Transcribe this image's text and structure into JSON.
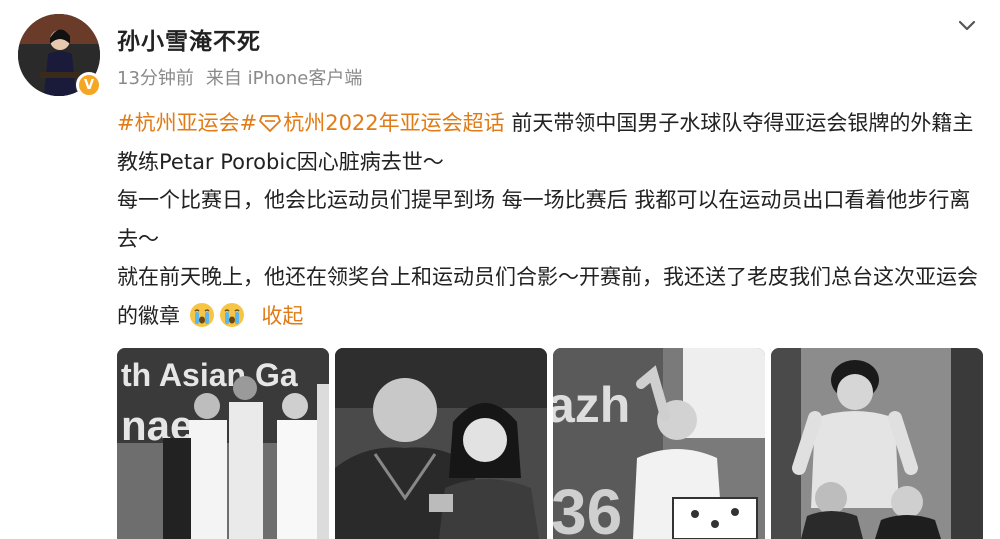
{
  "post": {
    "username": "孙小雪淹不死",
    "time": "13分钟前",
    "source": "来自 iPhone客户端",
    "hashtag1": "#杭州亚运会#",
    "hashtag2": "杭州2022年亚运会超话",
    "line1_rest": " 前天带领中国男子水球队夺得亚运会银牌的外籍主教练Petar Porobic因心脏病去世～",
    "line2": "每一个比赛日，他会比运动员们提早到场 每一场比赛后 我都可以在运动员出口看着他步行离去～",
    "line3": "就在前天晚上，他还在领奖台上和运动员们合影～开赛前，我还送了老皮我们总台这次亚运会的徽章",
    "collapse": "收起"
  },
  "photo_texts": {
    "photo1_sign": "th Asian Ga",
    "photo1_sign2": "nae",
    "photo3_sign": "azh",
    "photo3_num": "36"
  },
  "colors": {
    "accent": "#e07b16",
    "meta": "#8a8a8a",
    "text": "#222222"
  },
  "icons": [
    "verified-badge-icon",
    "chevron-down-icon",
    "super-topic-icon",
    "crying-emoji-icon"
  ]
}
